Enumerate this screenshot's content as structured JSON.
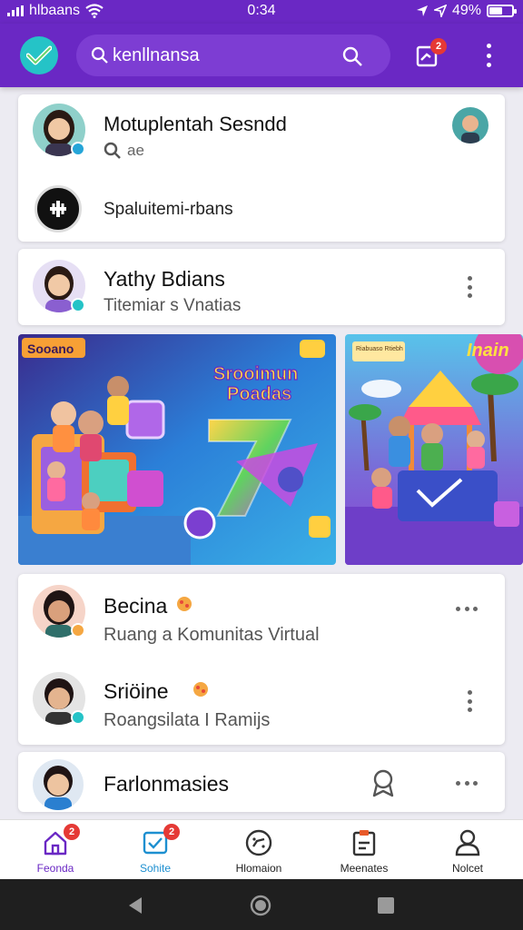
{
  "status_bar": {
    "carrier": "hlbaans",
    "time": "0:34",
    "battery": "49%"
  },
  "header": {
    "search_text": "kenllnansa",
    "inbox_badge": "2"
  },
  "card1": {
    "title": "Motuplentah Sesndd",
    "meta": "ae",
    "action_label": "Spaluitemi-rbans"
  },
  "card2": {
    "title": "Yathy Bdians",
    "subtitle": "Titemiar s Vnatias"
  },
  "banner_left": {
    "tag": "Sooano",
    "headline_1": "Srooimun",
    "headline_2": "Poadas"
  },
  "banner_right": {
    "tag": "Riabuaso Rtiebh",
    "headline": "Inain"
  },
  "card3": {
    "row1": {
      "title": "Becina",
      "subtitle": "Ruang a Komunitas Virtual"
    },
    "row2": {
      "title": "Sriöine",
      "subtitle": "Roangsilata I Ramijs"
    }
  },
  "card4": {
    "title": "Farlonmasies"
  },
  "bottom_nav": [
    {
      "label": "Feonda",
      "badge": "2",
      "active": true
    },
    {
      "label": "Sohite",
      "badge": "2",
      "active": false
    },
    {
      "label": "Hlomaion",
      "badge": "",
      "active": false
    },
    {
      "label": "Meenates",
      "badge": "",
      "active": false
    },
    {
      "label": "Nolcet",
      "badge": "",
      "active": false
    }
  ],
  "colors": {
    "primary": "#6a28c4",
    "accent_teal": "#25c3c7",
    "badge_red": "#e53935"
  }
}
